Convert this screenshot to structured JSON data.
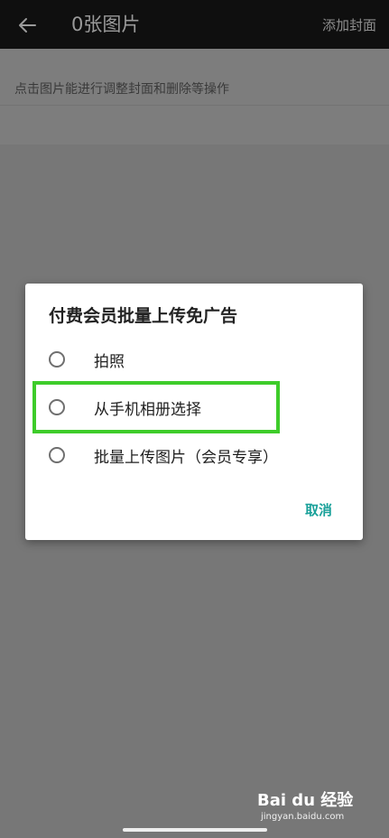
{
  "header": {
    "title": "0张图片",
    "add_cover_label": "添加封面"
  },
  "hint": {
    "text": "点击图片能进行调整封面和删除等操作"
  },
  "dialog": {
    "title": "付费会员批量上传免广告",
    "options": [
      {
        "label": "拍照"
      },
      {
        "label": "从手机相册选择"
      },
      {
        "label": "批量上传图片（会员专享）"
      }
    ],
    "cancel_label": "取消"
  },
  "watermark": {
    "logo_text": "Bai du 经验",
    "url": "jingyan.baidu.com"
  },
  "colors": {
    "accent": "#1aa19a",
    "highlight": "#3ecc2a",
    "topbar": "#0f0f0f"
  },
  "icons": {
    "back": "arrow-left-icon",
    "radio": "radio-unchecked-icon"
  }
}
